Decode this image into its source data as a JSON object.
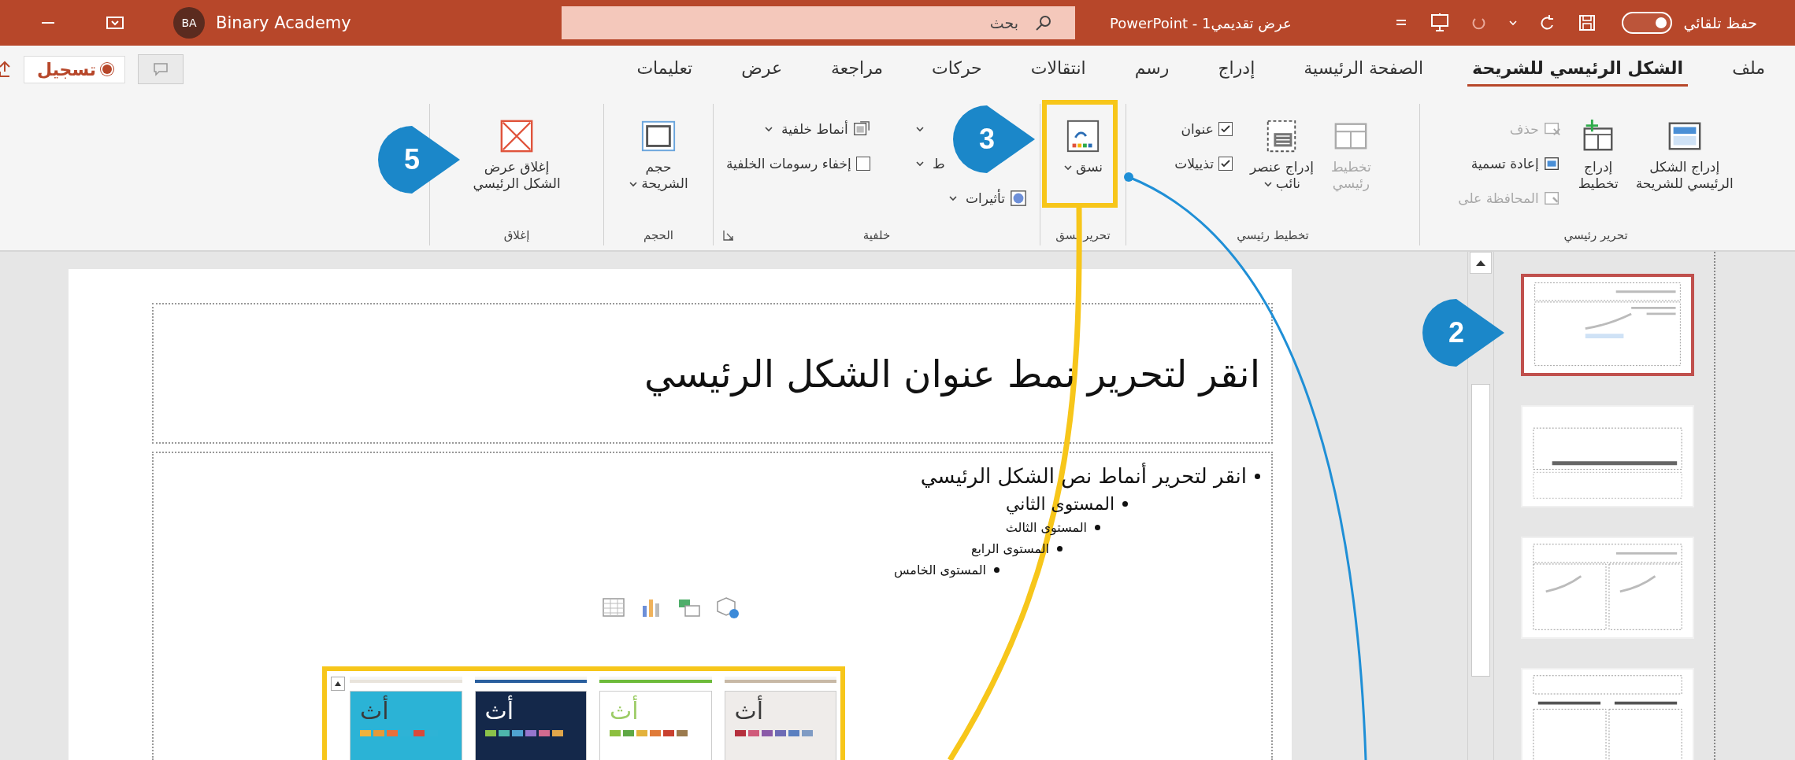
{
  "title_bar": {
    "account_initials": "BA",
    "account_name": "Binary Academy",
    "search": {
      "placeholder": "بحث"
    },
    "document_title": "عرض تقديمي1 - PowerPoint",
    "autosave": {
      "label": "حفظ تلقائي",
      "on": true
    }
  },
  "tabs": [
    {
      "label": "ملف",
      "selected": false
    },
    {
      "label": "الشكل الرئيسي للشريحة",
      "selected": true
    },
    {
      "label": "الصفحة الرئيسية",
      "selected": false
    },
    {
      "label": "إدراج",
      "selected": false
    },
    {
      "label": "رسم",
      "selected": false
    },
    {
      "label": "انتقالات",
      "selected": false
    },
    {
      "label": "حركات",
      "selected": false
    },
    {
      "label": "مراجعة",
      "selected": false
    },
    {
      "label": "عرض",
      "selected": false
    },
    {
      "label": "تعليمات",
      "selected": false
    }
  ],
  "tab_actions": {
    "record_label": "تسجيل"
  },
  "ribbon_groups": [
    {
      "label": "تحرير رئيسي",
      "columns": [
        [
          {
            "kind": "large",
            "label": "إدراج الشكل\nالرئيسي للشريحة",
            "disabled": false
          }
        ],
        [
          {
            "kind": "large",
            "label": "إدراج\nتخطيط",
            "disabled": false
          }
        ],
        [
          {
            "kind": "small",
            "label": "حذف",
            "disabled": true
          },
          {
            "kind": "small",
            "label": "إعادة تسمية",
            "disabled": false
          },
          {
            "kind": "small",
            "label": "المحافظة على",
            "disabled": true
          }
        ]
      ]
    },
    {
      "label": "تخطيط رئيسي",
      "columns": [
        [
          {
            "kind": "large",
            "label": "تخطيط\nرئيسي",
            "disabled": true
          }
        ],
        [
          {
            "kind": "large",
            "label": "إدراج عنصر\nنائب",
            "caret": true,
            "disabled": false
          }
        ],
        [
          {
            "kind": "check",
            "label": "عنوان",
            "checked": true
          },
          {
            "kind": "check",
            "label": "تذييلات",
            "checked": true
          }
        ]
      ]
    },
    {
      "label": "تحرير نسق",
      "columns": [
        [
          {
            "kind": "large",
            "label": "نسق",
            "caret": true,
            "disabled": false
          }
        ]
      ]
    },
    {
      "label": "خلفية",
      "launcher": true,
      "columns": [
        [
          {
            "kind": "small",
            "caret": true,
            "disabled": false
          },
          {
            "kind": "small",
            "label": "ط",
            "caret": true,
            "disabled": false
          },
          {
            "kind": "small",
            "label": "تأثيرات",
            "caret": true,
            "disabled": false
          }
        ],
        [
          {
            "kind": "small",
            "label": "أنماط خلفية",
            "caret": true,
            "disabled": false
          },
          {
            "kind": "check",
            "label": "إخفاء رسومات الخلفية",
            "checked": false
          }
        ]
      ]
    },
    {
      "label": "الحجم",
      "columns": [
        [
          {
            "kind": "large",
            "label": "حجم\nالشريحة",
            "caret": true,
            "disabled": false
          }
        ]
      ]
    },
    {
      "label": "إغلاق",
      "columns": [
        [
          {
            "kind": "large",
            "label": "إغلاق عرض\nالشكل الرئيسي",
            "disabled": false
          }
        ]
      ]
    }
  ],
  "slide": {
    "title": "انقر لتحرير نمط عنوان الشكل الرئيسي",
    "body": [
      {
        "text": "انقر لتحرير أنماط نص الشكل الرئيسي",
        "children": [
          {
            "text": "المستوى الثاني",
            "children": [
              {
                "text": "المستوى الثالث",
                "children": [
                  {
                    "text": "المستوى الرابع",
                    "children": [
                      {
                        "text": "المستوى الخامس"
                      }
                    ]
                  }
                ]
              }
            ]
          }
        ]
      }
    ]
  },
  "theme_gallery": {
    "items": [
      {
        "label": "أث",
        "color": "#efecea"
      },
      {
        "label": "أث",
        "color": "#ffffff"
      },
      {
        "label": "أث",
        "color": "#14284a"
      },
      {
        "label": "أث",
        "color": "#2bb3d6"
      }
    ]
  },
  "layouts": [
    {
      "kind": "title-content",
      "selected": true
    },
    {
      "kind": "title",
      "selected": false
    },
    {
      "kind": "two-content",
      "selected": false
    },
    {
      "kind": "comparison",
      "selected": false
    }
  ],
  "callouts": [
    {
      "number": "5"
    },
    {
      "number": "3"
    },
    {
      "number": "2"
    }
  ]
}
